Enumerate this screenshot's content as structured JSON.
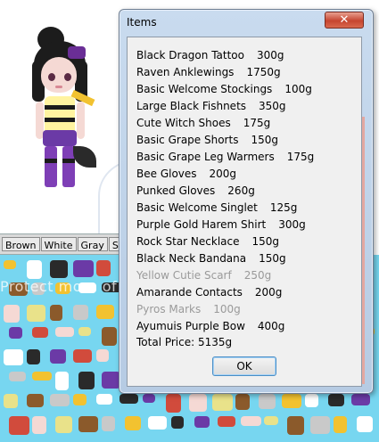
{
  "background": {
    "color_buttons": [
      "Brown",
      "White",
      "Gray",
      "Sil"
    ],
    "watermark": "Protect more of your memories for less!"
  },
  "dialog": {
    "title": "Items",
    "close_label": "✕",
    "items": [
      {
        "name": "Black Dragon Tattoo",
        "price": "300g",
        "greyed": false
      },
      {
        "name": "Raven Anklewings",
        "price": "1750g",
        "greyed": false
      },
      {
        "name": "Basic Welcome Stockings",
        "price": "100g",
        "greyed": false
      },
      {
        "name": "Large Black Fishnets",
        "price": "350g",
        "greyed": false
      },
      {
        "name": "Cute Witch Shoes",
        "price": "175g",
        "greyed": false
      },
      {
        "name": "Basic Grape Shorts",
        "price": "150g",
        "greyed": false
      },
      {
        "name": "Basic Grape Leg Warmers",
        "price": "175g",
        "greyed": false
      },
      {
        "name": "Bee Gloves",
        "price": "200g",
        "greyed": false
      },
      {
        "name": "Punked Gloves",
        "price": "260g",
        "greyed": false
      },
      {
        "name": "Basic Welcome Singlet",
        "price": "125g",
        "greyed": false
      },
      {
        "name": "Purple Gold Harem Shirt",
        "price": "300g",
        "greyed": false
      },
      {
        "name": "Rock Star Necklace",
        "price": "150g",
        "greyed": false
      },
      {
        "name": "Black Neck Bandana",
        "price": "150g",
        "greyed": false
      },
      {
        "name": "Yellow Cutie Scarf",
        "price": "250g",
        "greyed": true
      },
      {
        "name": "Amarande Contacts",
        "price": "200g",
        "greyed": false
      },
      {
        "name": "Pyros Marks",
        "price": "100g",
        "greyed": true
      },
      {
        "name": "Ayumuis Purple Bow",
        "price": "400g",
        "greyed": false
      }
    ],
    "total": "Total Price: 5135g",
    "ok_label": "OK"
  }
}
